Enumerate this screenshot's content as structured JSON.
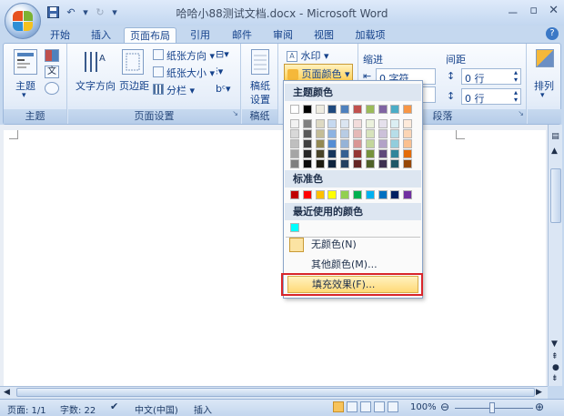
{
  "window": {
    "title": "哈哈小88测试文档.docx - Microsoft Word",
    "minimize": "－",
    "maximize": "▫",
    "close": "✕"
  },
  "tabs": [
    "开始",
    "插入",
    "页面布局",
    "引用",
    "邮件",
    "审阅",
    "视图",
    "加载项"
  ],
  "active_tab": "页面布局",
  "ribbon": {
    "theme": {
      "label": "主题",
      "group": "主题"
    },
    "page_setup": {
      "text_dir": "文字方向",
      "margins": "页边距",
      "orientation": "纸张方向",
      "size": "纸张大小",
      "columns": "分栏",
      "group": "页面设置"
    },
    "paper": {
      "label1": "稿纸",
      "label2": "设置",
      "group": "稿纸"
    },
    "background": {
      "watermark": "水印",
      "page_color": "页面颜色"
    },
    "paragraph": {
      "indent": "缩进",
      "spacing": "间距",
      "indent_left": "0 字符",
      "spacing_before": "0 行",
      "spacing_after": "0 行",
      "group": "段落"
    },
    "arrange": {
      "label": "排列"
    }
  },
  "dropdown": {
    "theme_colors": "主题颜色",
    "standard_colors": "标准色",
    "recent_colors": "最近使用的颜色",
    "no_color": "无颜色(N)",
    "more_colors": "其他颜色(M)...",
    "fill_effects": "填充效果(F)...",
    "theme_top": [
      "#ffffff",
      "#000000",
      "#eeece1",
      "#1f497d",
      "#4f81bd",
      "#c0504d",
      "#9bbb59",
      "#8064a2",
      "#4bacc6",
      "#f79646"
    ],
    "theme_shades": [
      [
        "#f2f2f2",
        "#d8d8d8",
        "#bfbfbf",
        "#a5a5a5",
        "#7f7f7f"
      ],
      [
        "#7f7f7f",
        "#595959",
        "#3f3f3f",
        "#262626",
        "#0c0c0c"
      ],
      [
        "#ddd9c3",
        "#c4bd97",
        "#938953",
        "#494429",
        "#1d1b10"
      ],
      [
        "#c6d9f0",
        "#8db3e2",
        "#548dd4",
        "#17365d",
        "#0f243e"
      ],
      [
        "#dbe5f1",
        "#b8cce4",
        "#95b3d7",
        "#366092",
        "#244061"
      ],
      [
        "#f2dcdb",
        "#e5b9b7",
        "#d99694",
        "#953734",
        "#632423"
      ],
      [
        "#ebf1dd",
        "#d7e3bc",
        "#c3d69b",
        "#76923c",
        "#4f6128"
      ],
      [
        "#e5e0ec",
        "#ccc1d9",
        "#b2a2c7",
        "#5f497a",
        "#3f3151"
      ],
      [
        "#dbeef3",
        "#b7dde8",
        "#92cddc",
        "#31859b",
        "#205867"
      ],
      [
        "#fdeada",
        "#fbd5b5",
        "#fac08f",
        "#e36c09",
        "#974806"
      ]
    ],
    "standard": [
      "#c00000",
      "#ff0000",
      "#ffc000",
      "#ffff00",
      "#92d050",
      "#00b050",
      "#00b0f0",
      "#0070c0",
      "#002060",
      "#7030a0"
    ],
    "recent": [
      "#00ffff"
    ]
  },
  "status": {
    "page": "页面: 1/1",
    "words": "字数: 22",
    "lang": "中文(中国)",
    "mode": "插入",
    "zoom": "100%"
  }
}
